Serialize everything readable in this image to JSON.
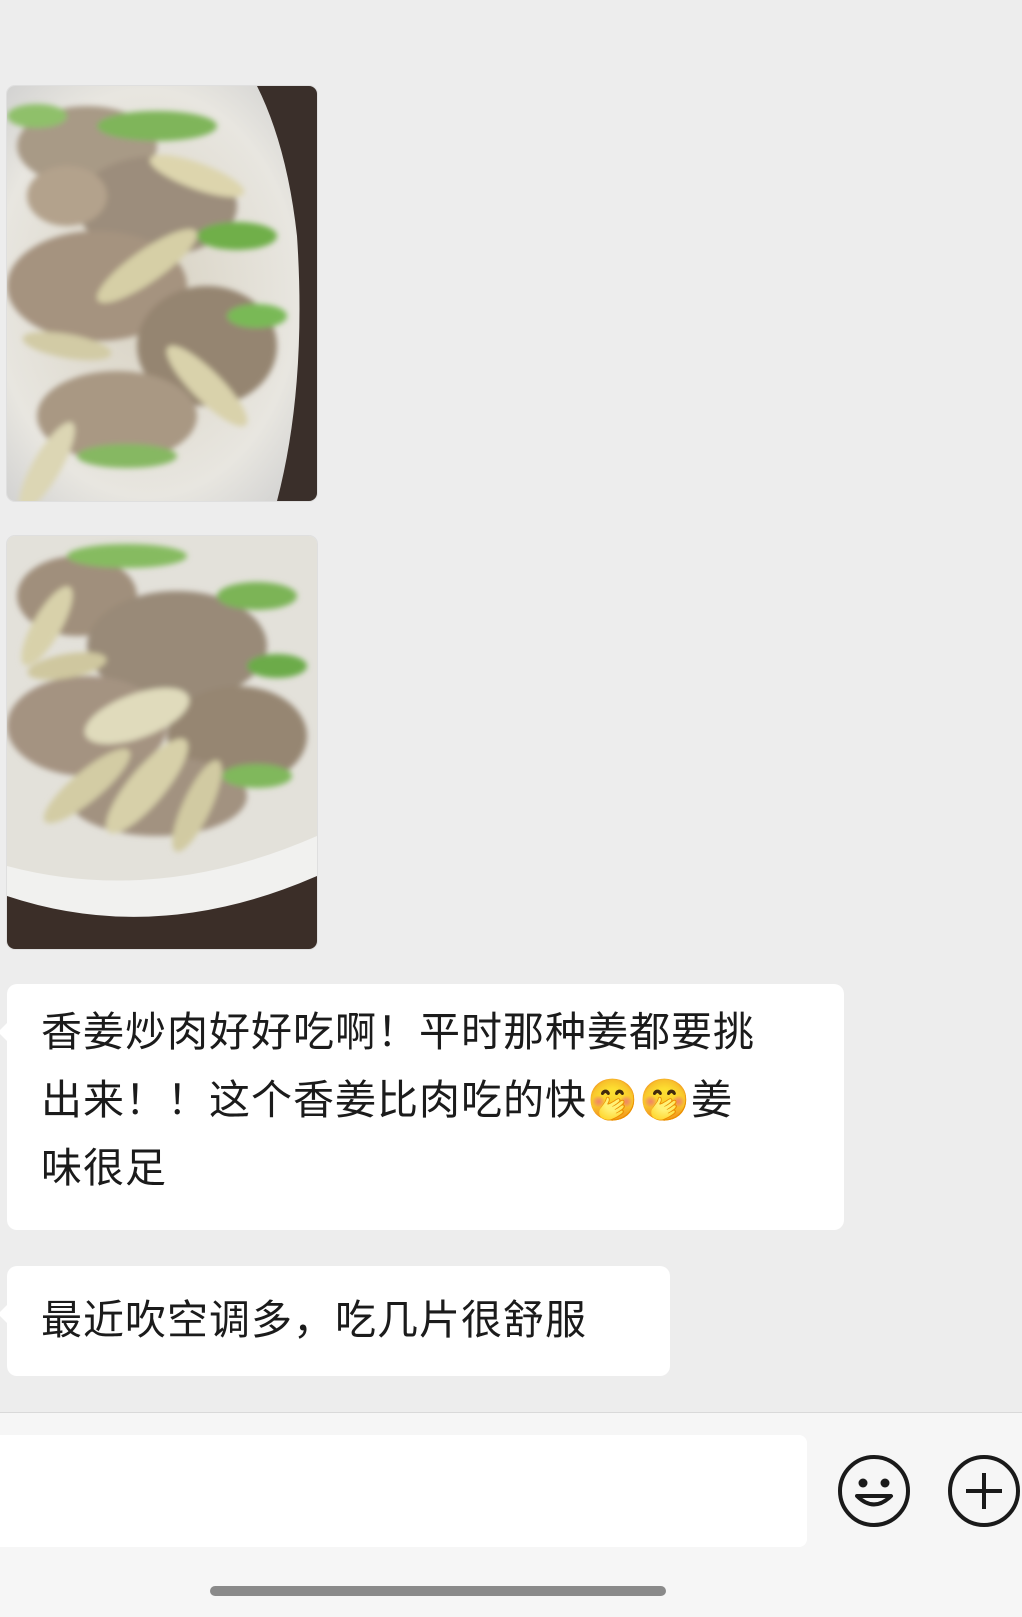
{
  "messages": [
    {
      "type": "image",
      "icon": "food-photo-ginger-pork"
    },
    {
      "type": "image",
      "icon": "food-photo-ginger-pork"
    },
    {
      "type": "text",
      "lines": [
        "香姜炒肉好好吃啊！平时那种姜都要挑",
        "出来！！这个香姜比肉吃的快🤭🤭姜",
        "味很足"
      ]
    },
    {
      "type": "text",
      "lines": [
        "最近吹空调多，吃几片很舒服"
      ]
    }
  ],
  "input_bar": {
    "input_value": "",
    "emoji_icon": "smiley-face-icon",
    "plus_icon": "plus-circle-icon"
  },
  "colors": {
    "background": "#ededed",
    "bubble": "#ffffff",
    "text": "#1b1b1b",
    "bar": "#f6f6f6"
  }
}
